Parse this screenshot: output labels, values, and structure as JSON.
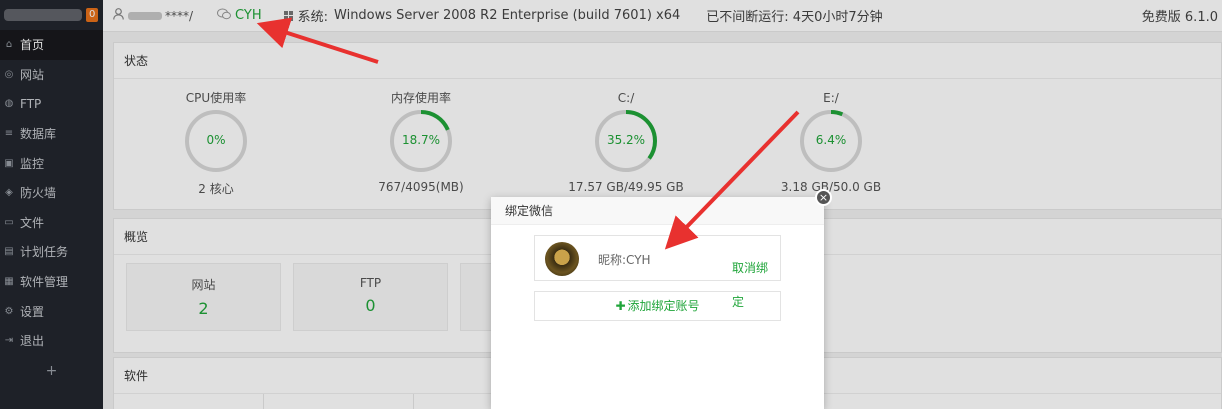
{
  "sidebar": {
    "badge": "0",
    "items": [
      {
        "label": "首页",
        "icon": "home-icon",
        "glyph": "⌂"
      },
      {
        "label": "网站",
        "icon": "globe-icon",
        "glyph": "◎"
      },
      {
        "label": "FTP",
        "icon": "ftp-icon",
        "glyph": "◍"
      },
      {
        "label": "数据库",
        "icon": "database-icon",
        "glyph": "≡"
      },
      {
        "label": "监控",
        "icon": "monitor-icon",
        "glyph": "▣"
      },
      {
        "label": "防火墙",
        "icon": "shield-icon",
        "glyph": "◈"
      },
      {
        "label": "文件",
        "icon": "folder-icon",
        "glyph": "▭"
      },
      {
        "label": "计划任务",
        "icon": "calendar-icon",
        "glyph": "▤"
      },
      {
        "label": "软件管理",
        "icon": "apps-icon",
        "glyph": "▦"
      },
      {
        "label": "设置",
        "icon": "gear-icon",
        "glyph": "⚙"
      },
      {
        "label": "退出",
        "icon": "logout-icon",
        "glyph": "⇥"
      }
    ],
    "add": "+"
  },
  "topbar": {
    "user": "****/",
    "wechat_name": "CYH",
    "os_label": "系统:",
    "os_value": "Windows Server 2008 R2 Enterprise (build 7601) x64",
    "uptime": "已不间断运行: 4天0小时7分钟",
    "version": "免费版 6.1.0"
  },
  "status": {
    "title": "状态",
    "gauges": [
      {
        "label": "CPU使用率",
        "value": "0%",
        "percent": 0,
        "sub": "2 核心"
      },
      {
        "label": "内存使用率",
        "value": "18.7%",
        "percent": 18.7,
        "sub": "767/4095(MB)"
      },
      {
        "label": "C:/",
        "value": "35.2%",
        "percent": 35.2,
        "sub": "17.57 GB/49.95 GB"
      },
      {
        "label": "E:/",
        "value": "6.4%",
        "percent": 6.4,
        "sub": "3.18 GB/50.0 GB"
      }
    ]
  },
  "overview": {
    "title": "概览",
    "cards": [
      {
        "label": "网站",
        "value": "2"
      },
      {
        "label": "FTP",
        "value": "0"
      }
    ]
  },
  "software": {
    "title": "软件"
  },
  "dialog": {
    "title": "绑定微信",
    "nickname": "昵称:CYH",
    "unbind": "取消绑定",
    "add_button": "添加绑定账号",
    "close": "×"
  },
  "colors": {
    "accent": "#20a53a",
    "arrow": "#e8312f"
  }
}
